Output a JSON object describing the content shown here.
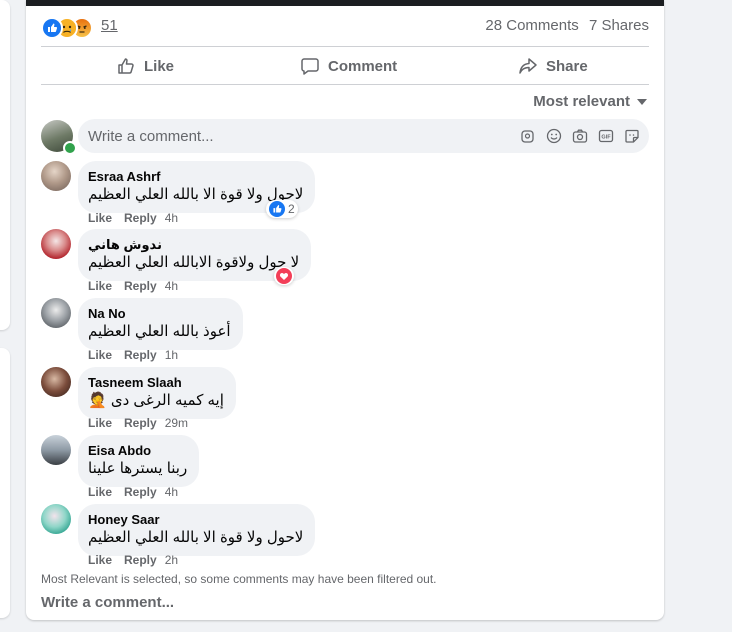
{
  "post": {
    "reaction_count": "51",
    "reaction_icons": [
      "like-icon",
      "sad-icon",
      "angry-icon"
    ],
    "comments_count": "28 Comments",
    "shares_count": "7 Shares"
  },
  "actions": {
    "like": "Like",
    "comment": "Comment",
    "share": "Share"
  },
  "sort_label": "Most relevant",
  "composer": {
    "placeholder": "Write a comment..."
  },
  "comments": [
    {
      "author": "Esraa Ashrf",
      "text": "لاحول ولا قوة الا بالله العلي العظيم",
      "like": "Like",
      "reply": "Reply",
      "time": "4h",
      "reaction": "like",
      "reaction_count": "2"
    },
    {
      "author": "ندوش هاني",
      "text": "لا حول ولاقوة الابالله العلي العظيم",
      "like": "Like",
      "reply": "Reply",
      "time": "4h",
      "reaction": "love",
      "reaction_count": ""
    },
    {
      "author": "Na No",
      "text": "أعوذ بالله العلي العظيم",
      "like": "Like",
      "reply": "Reply",
      "time": "1h"
    },
    {
      "author": "Tasneem Slaah",
      "text": "إيه كميه الرغى دى 🤦",
      "like": "Like",
      "reply": "Reply",
      "time": "29m"
    },
    {
      "author": "Eisa Abdo",
      "text": "ربنا يسترها علينا",
      "like": "Like",
      "reply": "Reply",
      "time": "4h"
    },
    {
      "author": "Honey Saar",
      "text": "لاحول ولا قوة الا بالله العلي العظيم",
      "like": "Like",
      "reply": "Reply",
      "time": "2h"
    }
  ],
  "footer": {
    "filter_note": "Most Relevant is selected, so some comments may have been filtered out.",
    "write_comment": "Write a comment..."
  },
  "colors": {
    "like_blue": "#1877f2",
    "love_red": "#f33e58",
    "muted_text": "#65676b",
    "bubble_bg": "#f0f2f5"
  }
}
